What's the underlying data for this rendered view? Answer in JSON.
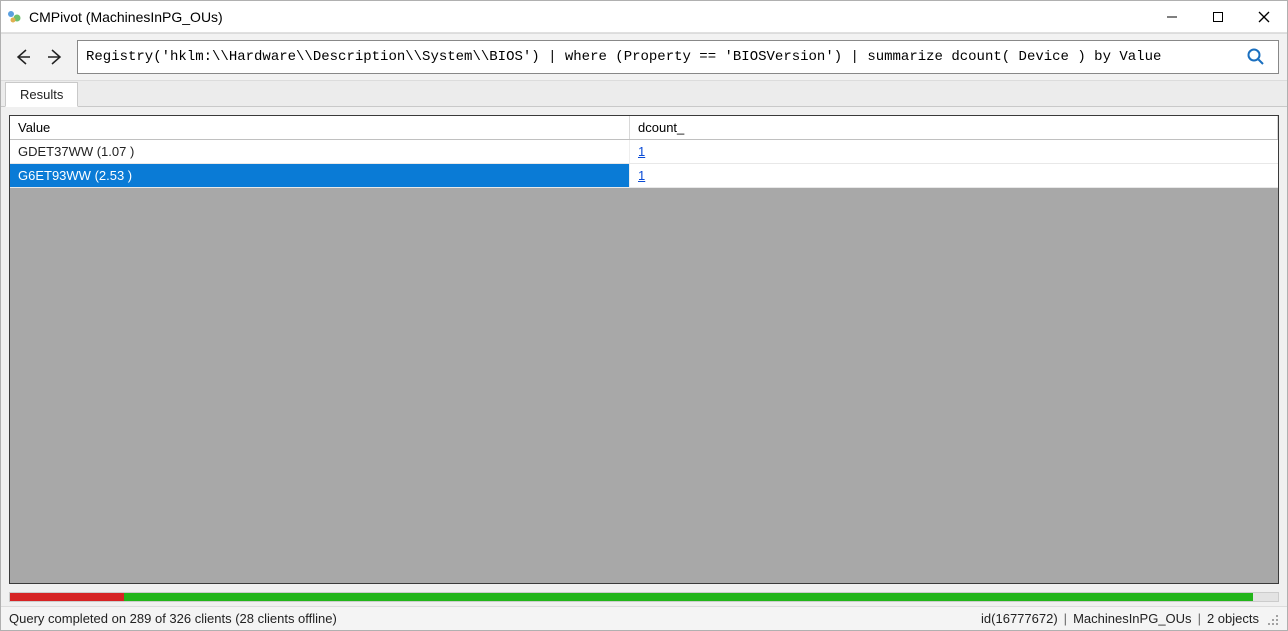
{
  "window": {
    "title": "CMPivot (MachinesInPG_OUs)"
  },
  "toolbar": {
    "query": "Registry('hklm:\\\\Hardware\\\\Description\\\\System\\\\BIOS') | where (Property == 'BIOSVersion') | summarize dcount( Device ) by Value"
  },
  "tabs": {
    "results": "Results"
  },
  "grid": {
    "columns": {
      "value": "Value",
      "dcount": "dcount_"
    },
    "rows": [
      {
        "value": "GDET37WW (1.07 )",
        "dcount": "1",
        "selected": false
      },
      {
        "value": "G6ET93WW (2.53 )",
        "dcount": "1",
        "selected": true
      }
    ]
  },
  "progress": {
    "red_pct": 9,
    "green_pct": 89,
    "gray_pct": 2
  },
  "status": {
    "left": "Query completed on 289 of 326 clients (28 clients offline)",
    "id": "id(16777672)",
    "collection": "MachinesInPG_OUs",
    "objects": "2 objects"
  }
}
